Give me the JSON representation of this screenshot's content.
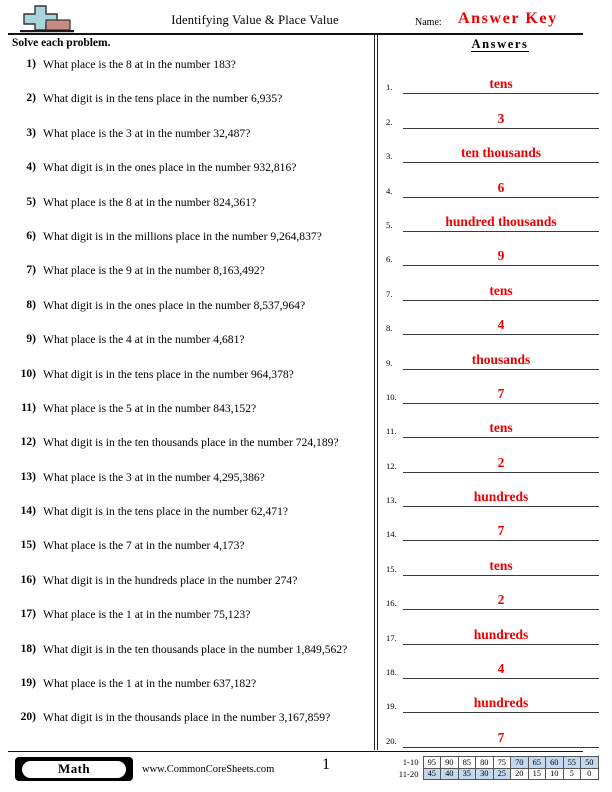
{
  "header": {
    "title": "Identifying Value & Place Value",
    "name_label": "Name:",
    "name_value": "Answer Key",
    "logo_icon": "plus-block-logo"
  },
  "instructions": "Solve each problem.",
  "answers_heading": "Answers",
  "colors": {
    "answer_red": "#ee0000",
    "score_shaded": "#c3d9f0",
    "logo_plus": "#a8d5dd",
    "logo_block": "#c98b86"
  },
  "questions": [
    {
      "num": "1)",
      "text": "What place is the 8 at in the number 183?"
    },
    {
      "num": "2)",
      "text": "What digit is in the tens place in the number 6,935?"
    },
    {
      "num": "3)",
      "text": "What place is the 3 at in the number 32,487?"
    },
    {
      "num": "4)",
      "text": "What digit is in the ones place in the number 932,816?"
    },
    {
      "num": "5)",
      "text": "What place is the 8 at in the number 824,361?"
    },
    {
      "num": "6)",
      "text": "What digit is in the millions place in the number 9,264,837?"
    },
    {
      "num": "7)",
      "text": "What place is the 9 at in the number 8,163,492?"
    },
    {
      "num": "8)",
      "text": "What digit is in the ones place in the number 8,537,964?"
    },
    {
      "num": "9)",
      "text": "What place is the 4 at in the number 4,681?"
    },
    {
      "num": "10)",
      "text": "What digit is in the tens place in the number 964,378?"
    },
    {
      "num": "11)",
      "text": "What place is the 5 at in the number 843,152?"
    },
    {
      "num": "12)",
      "text": "What digit is in the ten thousands place in the number 724,189?"
    },
    {
      "num": "13)",
      "text": "What place is the 3 at in the number 4,295,386?"
    },
    {
      "num": "14)",
      "text": "What digit is in the tens place in the number 62,471?"
    },
    {
      "num": "15)",
      "text": "What place is the 7 at in the number 4,173?"
    },
    {
      "num": "16)",
      "text": "What digit is in the hundreds place in the number 274?"
    },
    {
      "num": "17)",
      "text": "What place is the 1 at in the number 75,123?"
    },
    {
      "num": "18)",
      "text": "What digit is in the ten thousands place in the number 1,849,562?"
    },
    {
      "num": "19)",
      "text": "What place is the 1 at in the number 637,182?"
    },
    {
      "num": "20)",
      "text": "What digit is in the thousands place in the number 3,167,859?"
    }
  ],
  "answers": [
    {
      "num": "1.",
      "value": "tens"
    },
    {
      "num": "2.",
      "value": "3"
    },
    {
      "num": "3.",
      "value": "ten thousands"
    },
    {
      "num": "4.",
      "value": "6"
    },
    {
      "num": "5.",
      "value": "hundred thousands"
    },
    {
      "num": "6.",
      "value": "9"
    },
    {
      "num": "7.",
      "value": "tens"
    },
    {
      "num": "8.",
      "value": "4"
    },
    {
      "num": "9.",
      "value": "thousands"
    },
    {
      "num": "10.",
      "value": "7"
    },
    {
      "num": "11.",
      "value": "tens"
    },
    {
      "num": "12.",
      "value": "2"
    },
    {
      "num": "13.",
      "value": "hundreds"
    },
    {
      "num": "14.",
      "value": "7"
    },
    {
      "num": "15.",
      "value": "tens"
    },
    {
      "num": "16.",
      "value": "2"
    },
    {
      "num": "17.",
      "value": "hundreds"
    },
    {
      "num": "18.",
      "value": "4"
    },
    {
      "num": "19.",
      "value": "hundreds"
    },
    {
      "num": "20.",
      "value": "7"
    }
  ],
  "footer": {
    "subject_badge": "Math",
    "site_url": "www.CommonCoreSheets.com",
    "page_number": "1"
  },
  "score_table": {
    "rows": [
      {
        "label": "1-10",
        "cells": [
          {
            "v": "95",
            "shaded": false
          },
          {
            "v": "90",
            "shaded": false
          },
          {
            "v": "85",
            "shaded": false
          },
          {
            "v": "80",
            "shaded": false
          },
          {
            "v": "75",
            "shaded": false
          },
          {
            "v": "70",
            "shaded": true
          },
          {
            "v": "65",
            "shaded": true
          },
          {
            "v": "60",
            "shaded": true
          },
          {
            "v": "55",
            "shaded": true
          },
          {
            "v": "50",
            "shaded": true
          }
        ]
      },
      {
        "label": "11-20",
        "cells": [
          {
            "v": "45",
            "shaded": true
          },
          {
            "v": "40",
            "shaded": true
          },
          {
            "v": "35",
            "shaded": true
          },
          {
            "v": "30",
            "shaded": true
          },
          {
            "v": "25",
            "shaded": true
          },
          {
            "v": "20",
            "shaded": false
          },
          {
            "v": "15",
            "shaded": false
          },
          {
            "v": "10",
            "shaded": false
          },
          {
            "v": "5",
            "shaded": false
          },
          {
            "v": "0",
            "shaded": false
          }
        ]
      }
    ]
  }
}
